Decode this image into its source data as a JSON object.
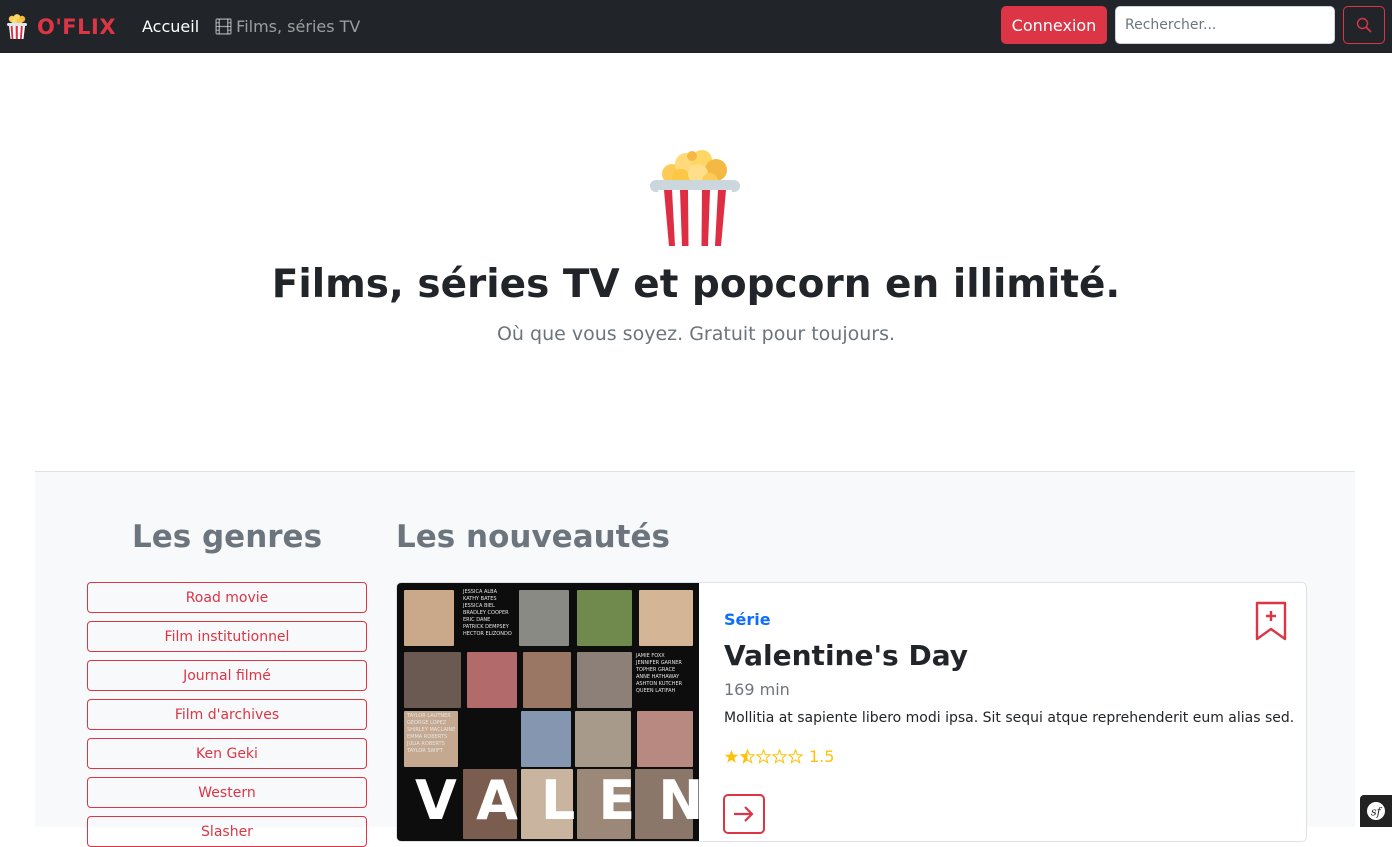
{
  "navbar": {
    "brand": "O'FLIX",
    "brand_icon": "popcorn-icon",
    "home_label": "Accueil",
    "catalog_label": "Films, séries TV",
    "catalog_icon": "film-icon",
    "login_label": "Connexion",
    "search_placeholder": "Rechercher...",
    "search_icon": "search-icon"
  },
  "hero": {
    "icon": "popcorn-icon",
    "title": "Films, séries TV et popcorn en illimité.",
    "subtitle": "Où que vous soyez. Gratuit pour toujours."
  },
  "genres": {
    "title": "Les genres",
    "items": [
      "Road movie",
      "Film institutionnel",
      "Journal filmé",
      "Film d'archives",
      "Ken Geki",
      "Western",
      "Slasher"
    ]
  },
  "news": {
    "title": "Les nouveautés",
    "items": [
      {
        "type": "Série",
        "title": "Valentine's Day",
        "duration": "169 min",
        "synopsis": "Mollitia at sapiente libero modi ipsa. Sit sequi atque reprehenderit eum alias sed.",
        "rating": 1.5,
        "rating_label": "1.5",
        "rating_max": 5,
        "poster": {
          "credits_top": [
            "JESSICA ALBA",
            "KATHY BATES",
            "JESSICA BIEL",
            "BRADLEY COOPER",
            "ERIC DANE",
            "PATRICK DEMPSEY",
            "HECTOR ELIZONDO"
          ],
          "credits_right": [
            "JAMIE FOXX",
            "JENNIFER GARNER",
            "TOPHER GRACE",
            "ANNE HATHAWAY",
            "ASHTON KUTCHER",
            "QUEEN LATIFAH"
          ],
          "credits_left": [
            "TAYLOR LAUTNER",
            "GEORGE LOPEZ",
            "SHIRLEY MACLAINE",
            "EMMA ROBERTS",
            "JULIA ROBERTS",
            "TAYLOR SWIFT"
          ],
          "letters": "VALEN"
        }
      }
    ]
  },
  "colors": {
    "danger": "#dc3545",
    "primary": "#0d6efd",
    "warning": "#ffc107",
    "dark": "#212529",
    "muted": "#6c757d"
  }
}
